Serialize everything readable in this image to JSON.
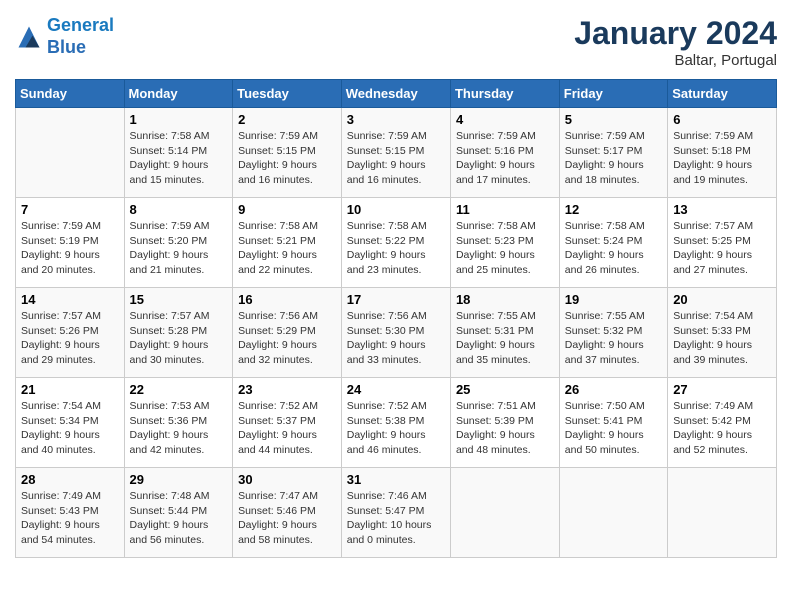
{
  "header": {
    "logo_line1": "General",
    "logo_line2": "Blue",
    "month_title": "January 2024",
    "location": "Baltar, Portugal"
  },
  "columns": [
    "Sunday",
    "Monday",
    "Tuesday",
    "Wednesday",
    "Thursday",
    "Friday",
    "Saturday"
  ],
  "weeks": [
    [
      {
        "day": "",
        "sunrise": "",
        "sunset": "",
        "daylight": ""
      },
      {
        "day": "1",
        "sunrise": "Sunrise: 7:58 AM",
        "sunset": "Sunset: 5:14 PM",
        "daylight": "Daylight: 9 hours and 15 minutes."
      },
      {
        "day": "2",
        "sunrise": "Sunrise: 7:59 AM",
        "sunset": "Sunset: 5:15 PM",
        "daylight": "Daylight: 9 hours and 16 minutes."
      },
      {
        "day": "3",
        "sunrise": "Sunrise: 7:59 AM",
        "sunset": "Sunset: 5:15 PM",
        "daylight": "Daylight: 9 hours and 16 minutes."
      },
      {
        "day": "4",
        "sunrise": "Sunrise: 7:59 AM",
        "sunset": "Sunset: 5:16 PM",
        "daylight": "Daylight: 9 hours and 17 minutes."
      },
      {
        "day": "5",
        "sunrise": "Sunrise: 7:59 AM",
        "sunset": "Sunset: 5:17 PM",
        "daylight": "Daylight: 9 hours and 18 minutes."
      },
      {
        "day": "6",
        "sunrise": "Sunrise: 7:59 AM",
        "sunset": "Sunset: 5:18 PM",
        "daylight": "Daylight: 9 hours and 19 minutes."
      }
    ],
    [
      {
        "day": "7",
        "sunrise": "Sunrise: 7:59 AM",
        "sunset": "Sunset: 5:19 PM",
        "daylight": "Daylight: 9 hours and 20 minutes."
      },
      {
        "day": "8",
        "sunrise": "Sunrise: 7:59 AM",
        "sunset": "Sunset: 5:20 PM",
        "daylight": "Daylight: 9 hours and 21 minutes."
      },
      {
        "day": "9",
        "sunrise": "Sunrise: 7:58 AM",
        "sunset": "Sunset: 5:21 PM",
        "daylight": "Daylight: 9 hours and 22 minutes."
      },
      {
        "day": "10",
        "sunrise": "Sunrise: 7:58 AM",
        "sunset": "Sunset: 5:22 PM",
        "daylight": "Daylight: 9 hours and 23 minutes."
      },
      {
        "day": "11",
        "sunrise": "Sunrise: 7:58 AM",
        "sunset": "Sunset: 5:23 PM",
        "daylight": "Daylight: 9 hours and 25 minutes."
      },
      {
        "day": "12",
        "sunrise": "Sunrise: 7:58 AM",
        "sunset": "Sunset: 5:24 PM",
        "daylight": "Daylight: 9 hours and 26 minutes."
      },
      {
        "day": "13",
        "sunrise": "Sunrise: 7:57 AM",
        "sunset": "Sunset: 5:25 PM",
        "daylight": "Daylight: 9 hours and 27 minutes."
      }
    ],
    [
      {
        "day": "14",
        "sunrise": "Sunrise: 7:57 AM",
        "sunset": "Sunset: 5:26 PM",
        "daylight": "Daylight: 9 hours and 29 minutes."
      },
      {
        "day": "15",
        "sunrise": "Sunrise: 7:57 AM",
        "sunset": "Sunset: 5:28 PM",
        "daylight": "Daylight: 9 hours and 30 minutes."
      },
      {
        "day": "16",
        "sunrise": "Sunrise: 7:56 AM",
        "sunset": "Sunset: 5:29 PM",
        "daylight": "Daylight: 9 hours and 32 minutes."
      },
      {
        "day": "17",
        "sunrise": "Sunrise: 7:56 AM",
        "sunset": "Sunset: 5:30 PM",
        "daylight": "Daylight: 9 hours and 33 minutes."
      },
      {
        "day": "18",
        "sunrise": "Sunrise: 7:55 AM",
        "sunset": "Sunset: 5:31 PM",
        "daylight": "Daylight: 9 hours and 35 minutes."
      },
      {
        "day": "19",
        "sunrise": "Sunrise: 7:55 AM",
        "sunset": "Sunset: 5:32 PM",
        "daylight": "Daylight: 9 hours and 37 minutes."
      },
      {
        "day": "20",
        "sunrise": "Sunrise: 7:54 AM",
        "sunset": "Sunset: 5:33 PM",
        "daylight": "Daylight: 9 hours and 39 minutes."
      }
    ],
    [
      {
        "day": "21",
        "sunrise": "Sunrise: 7:54 AM",
        "sunset": "Sunset: 5:34 PM",
        "daylight": "Daylight: 9 hours and 40 minutes."
      },
      {
        "day": "22",
        "sunrise": "Sunrise: 7:53 AM",
        "sunset": "Sunset: 5:36 PM",
        "daylight": "Daylight: 9 hours and 42 minutes."
      },
      {
        "day": "23",
        "sunrise": "Sunrise: 7:52 AM",
        "sunset": "Sunset: 5:37 PM",
        "daylight": "Daylight: 9 hours and 44 minutes."
      },
      {
        "day": "24",
        "sunrise": "Sunrise: 7:52 AM",
        "sunset": "Sunset: 5:38 PM",
        "daylight": "Daylight: 9 hours and 46 minutes."
      },
      {
        "day": "25",
        "sunrise": "Sunrise: 7:51 AM",
        "sunset": "Sunset: 5:39 PM",
        "daylight": "Daylight: 9 hours and 48 minutes."
      },
      {
        "day": "26",
        "sunrise": "Sunrise: 7:50 AM",
        "sunset": "Sunset: 5:41 PM",
        "daylight": "Daylight: 9 hours and 50 minutes."
      },
      {
        "day": "27",
        "sunrise": "Sunrise: 7:49 AM",
        "sunset": "Sunset: 5:42 PM",
        "daylight": "Daylight: 9 hours and 52 minutes."
      }
    ],
    [
      {
        "day": "28",
        "sunrise": "Sunrise: 7:49 AM",
        "sunset": "Sunset: 5:43 PM",
        "daylight": "Daylight: 9 hours and 54 minutes."
      },
      {
        "day": "29",
        "sunrise": "Sunrise: 7:48 AM",
        "sunset": "Sunset: 5:44 PM",
        "daylight": "Daylight: 9 hours and 56 minutes."
      },
      {
        "day": "30",
        "sunrise": "Sunrise: 7:47 AM",
        "sunset": "Sunset: 5:46 PM",
        "daylight": "Daylight: 9 hours and 58 minutes."
      },
      {
        "day": "31",
        "sunrise": "Sunrise: 7:46 AM",
        "sunset": "Sunset: 5:47 PM",
        "daylight": "Daylight: 10 hours and 0 minutes."
      },
      {
        "day": "",
        "sunrise": "",
        "sunset": "",
        "daylight": ""
      },
      {
        "day": "",
        "sunrise": "",
        "sunset": "",
        "daylight": ""
      },
      {
        "day": "",
        "sunrise": "",
        "sunset": "",
        "daylight": ""
      }
    ]
  ]
}
